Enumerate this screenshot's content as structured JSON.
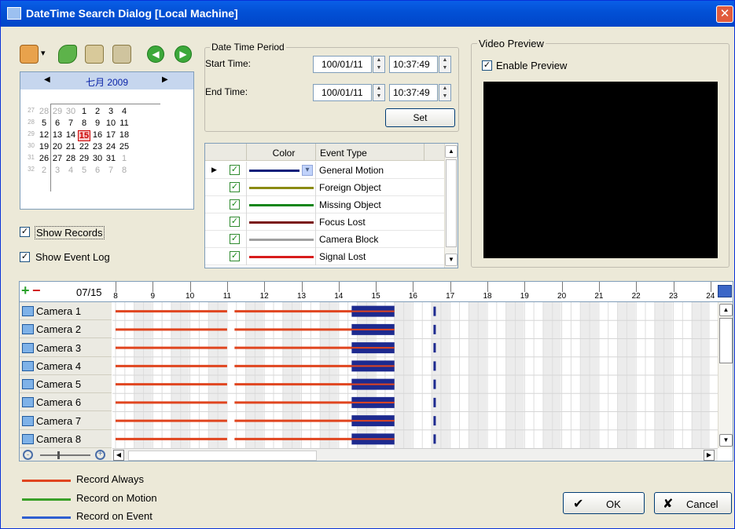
{
  "window": {
    "title": "DateTime Search Dialog  [Local Machine]",
    "close_glyph": "✕"
  },
  "toolbar": {
    "icons": [
      "home-icon",
      "link-icon",
      "search-record-icon",
      "event-search-icon",
      "prev-icon",
      "next-icon"
    ],
    "dropdown_glyph": "▾",
    "prev_glyph": "◀",
    "next_glyph": "▶"
  },
  "calendar": {
    "month_label": "七月 2009",
    "prev_glyph": "◀",
    "next_glyph": "▶",
    "weeks": [
      {
        "week": "27",
        "days": [
          "28",
          "29",
          "30",
          "1",
          "2",
          "3",
          "4"
        ],
        "other": [
          0,
          1,
          2
        ]
      },
      {
        "week": "28",
        "days": [
          "5",
          "6",
          "7",
          "8",
          "9",
          "10",
          "11"
        ],
        "other": []
      },
      {
        "week": "29",
        "days": [
          "12",
          "13",
          "14",
          "15",
          "16",
          "17",
          "18"
        ],
        "other": [],
        "selected": 3
      },
      {
        "week": "30",
        "days": [
          "19",
          "20",
          "21",
          "22",
          "23",
          "24",
          "25"
        ],
        "other": []
      },
      {
        "week": "31",
        "days": [
          "26",
          "27",
          "28",
          "29",
          "30",
          "31",
          "1"
        ],
        "other": [
          6
        ]
      },
      {
        "week": "32",
        "days": [
          "2",
          "3",
          "4",
          "5",
          "6",
          "7",
          "8"
        ],
        "other": [
          0,
          1,
          2,
          3,
          4,
          5,
          6
        ]
      }
    ]
  },
  "options": {
    "show_records": "Show Records",
    "show_event_log": "Show Event Log",
    "check_glyph": "✓"
  },
  "period": {
    "group_label": "Date Time Period",
    "start_label": "Start Time:",
    "start_date": "100/01/11",
    "start_time": "10:37:49",
    "end_label": "End Time:",
    "end_date": "100/01/11",
    "end_time": "10:37:49",
    "set_label": "Set",
    "spin_up": "▲",
    "spin_down": "▼"
  },
  "events": {
    "col_color": "Color",
    "col_type": "Event Type",
    "row_pointer": "▶",
    "dropdown_glyph": "▾",
    "scroll_up": "▲",
    "scroll_down": "▼",
    "rows": [
      {
        "type": "General Motion",
        "color": "#0b1f7a"
      },
      {
        "type": "Foreign Object",
        "color": "#8b8b12"
      },
      {
        "type": "Missing Object",
        "color": "#12861a"
      },
      {
        "type": "Focus Lost",
        "color": "#7a1414"
      },
      {
        "type": "Camera Block",
        "color": "#a0a0a0"
      },
      {
        "type": "Signal Lost",
        "color": "#d81c1c"
      }
    ]
  },
  "preview": {
    "group_label": "Video Preview",
    "enable_label": "Enable Preview"
  },
  "timeline": {
    "date_label": "07/15",
    "add_glyph": "+",
    "remove_glyph": "−",
    "grid_icon": "grid-icon",
    "hours": [
      "8",
      "9",
      "10",
      "11",
      "12",
      "13",
      "14",
      "15",
      "16",
      "17",
      "18",
      "19",
      "20",
      "21",
      "22",
      "23",
      "24"
    ],
    "cameras": [
      "Camera 1",
      "Camera 2",
      "Camera 3",
      "Camera 4",
      "Camera 5",
      "Camera 6",
      "Camera 7",
      "Camera 8"
    ],
    "record_always_color": "#e0451f",
    "event_color": "#1d2a8f",
    "zoom_out_glyph": "-",
    "zoom_in_glyph": "+",
    "scroll_left": "◀",
    "scroll_right": "▶",
    "scroll_up": "▲",
    "scroll_down": "▼"
  },
  "legend": [
    {
      "label": "Record Always",
      "color": "#e0451f"
    },
    {
      "label": "Record on Motion",
      "color": "#3aa028"
    },
    {
      "label": "Record on Event",
      "color": "#2f5fd0"
    }
  ],
  "buttons": {
    "ok": "OK",
    "ok_glyph": "✔",
    "cancel": "Cancel",
    "cancel_glyph": "✘"
  }
}
